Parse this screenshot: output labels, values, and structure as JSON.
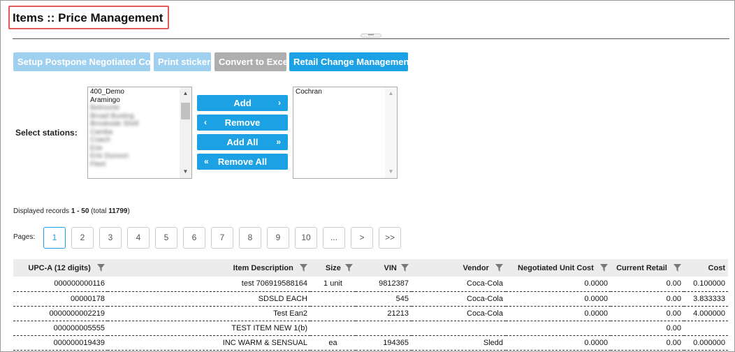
{
  "title": "Items :: Price Management",
  "splitter_glyph": "••••",
  "toolbar": {
    "setup_postpone": "Setup Postpone Negotiated Cost",
    "print_stickers": "Print stickers",
    "convert_excel": "Convert to Excel",
    "retail_change": "Retail Change Management"
  },
  "stations": {
    "label": "Select stations:",
    "available": [
      "400_Demo",
      "Aramingo",
      "Belmonte",
      "Broad Busting",
      "Brookside Shell",
      "Camba",
      "Coach",
      "Erie",
      "Erie Dunson",
      "Fleet"
    ],
    "selected": [
      "Cochran"
    ],
    "add": "Add",
    "remove": "Remove",
    "add_all": "Add All",
    "remove_all": "Remove All"
  },
  "records": {
    "prefix": "Displayed records ",
    "range": "1 - 50",
    "mid": " (total ",
    "total": "11799",
    "suffix": ")"
  },
  "pages": {
    "label": "Pages:",
    "items": [
      "1",
      "2",
      "3",
      "4",
      "5",
      "6",
      "7",
      "8",
      "9",
      "10",
      "...",
      ">",
      ">>"
    ],
    "active": "1"
  },
  "table": {
    "headers": {
      "upc": "UPC-A (12 digits)",
      "desc": "Item Description",
      "size": "Size",
      "vin": "VIN",
      "vendor": "Vendor",
      "neg_cost": "Negotiated Unit Cost",
      "retail": "Current Retail",
      "cost": "Cost"
    },
    "rows": [
      {
        "upc": "000000000116",
        "desc": "test 706919588164",
        "size": "1 unit",
        "vin": "9812387",
        "vendor": "Coca-Cola",
        "neg_cost": "0.0000",
        "retail": "0.00",
        "cost": "0.100000"
      },
      {
        "upc": "00000178",
        "desc": "SDSLD EACH",
        "size": "",
        "vin": "545",
        "vendor": "Coca-Cola",
        "neg_cost": "0.0000",
        "retail": "0.00",
        "cost": "3.833333"
      },
      {
        "upc": "0000000002219",
        "desc": "Test Ean2",
        "size": "",
        "vin": "21213",
        "vendor": "Coca-Cola",
        "neg_cost": "0.0000",
        "retail": "0.00",
        "cost": "4.000000"
      },
      {
        "upc": "000000005555",
        "desc": "TEST ITEM NEW 1(b)",
        "size": "",
        "vin": "",
        "vendor": "",
        "neg_cost": "",
        "retail": "0.00",
        "cost": ""
      },
      {
        "upc": "000000019439",
        "desc": "INC WARM & SENSUAL",
        "size": "ea",
        "vin": "194365",
        "vendor": "Sledd",
        "neg_cost": "0.0000",
        "retail": "0.00",
        "cost": "0.000000"
      }
    ]
  },
  "colors": {
    "accent": "#1ca1e4",
    "highlight_box": "#e05a5a"
  }
}
